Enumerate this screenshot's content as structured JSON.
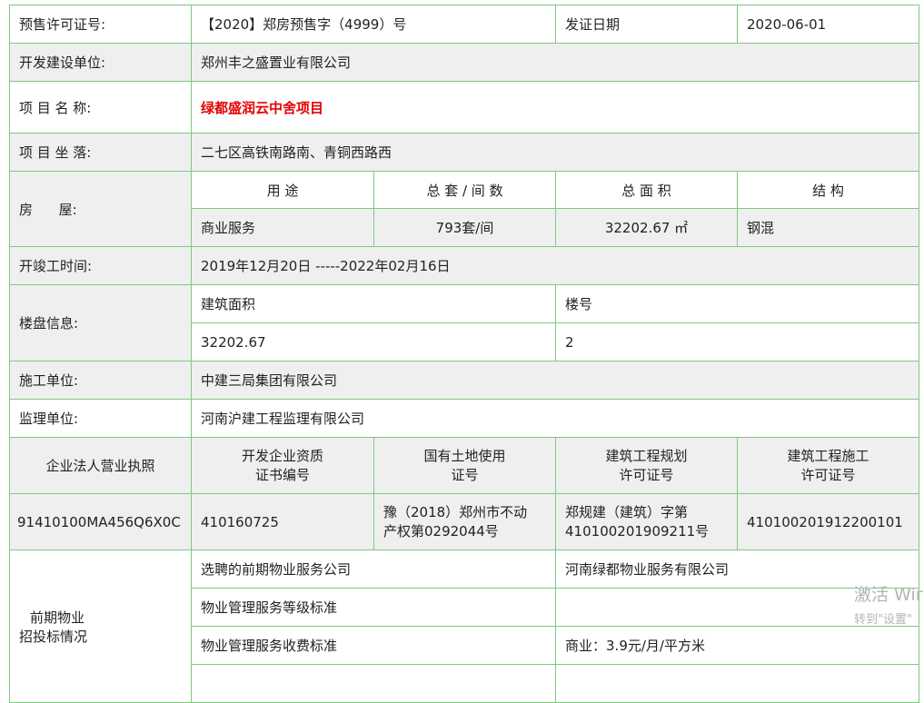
{
  "permit": {
    "label": "预售许可证号:",
    "value": "【2020】郑房预售字（4999）号",
    "issue_date_label": "发证日期",
    "issue_date": "2020-06-01"
  },
  "developer": {
    "label": "开发建设单位:",
    "value": "郑州丰之盛置业有限公司"
  },
  "project_name": {
    "label": "项 目 名 称:",
    "value": "绿都盛润云中舍项目",
    "highlight_color": "#e60000"
  },
  "location": {
    "label": "项 目 坐 落:",
    "value": "二七区高铁南路南、青铜西路西"
  },
  "housing": {
    "label": "房      屋:",
    "headers": [
      "用  途",
      "总 套 / 间 数",
      "总 面 积",
      "结 构"
    ],
    "values": [
      "商业服务",
      "793套/间",
      "32202.67 ㎡",
      "钢混"
    ]
  },
  "construction_period": {
    "label": "开竣工时间:",
    "value": "2019年12月20日 -----2022年02月16日"
  },
  "building": {
    "label": "楼盘信息:",
    "area_label": "建筑面积",
    "number_label": "楼号",
    "area_value": "32202.67",
    "number_value": "2"
  },
  "contractor": {
    "label": "施工单位:",
    "value": "中建三局集团有限公司"
  },
  "supervisor": {
    "label": "监理单位:",
    "value": "河南沪建工程监理有限公司"
  },
  "licenses": {
    "label": "企业法人营业执照",
    "headers": [
      [
        "开发企业资质",
        "证书编号"
      ],
      [
        "国有土地使用",
        "证号"
      ],
      [
        "建筑工程规划",
        "许可证号"
      ],
      [
        "建筑工程施工",
        "许可证号"
      ]
    ],
    "business_license": "91410100MA456Q6X0C",
    "qualification_no": "410160725",
    "land_use": [
      "豫（2018）郑州市不动",
      "产权第0292044号"
    ],
    "planning_permit": [
      "郑规建（建筑）字第",
      "410100201909211号"
    ],
    "construction_permit": "410100201912200101"
  },
  "property_mgmt": {
    "label": [
      "前期物业",
      "招投标情况"
    ],
    "company_label": "选聘的前期物业服务公司",
    "company_value": "河南绿都物业服务有限公司",
    "level_label": "物业管理服务等级标准",
    "level_value": "",
    "fee_label": "物业管理服务收费标准",
    "fee_value": "商业：3.9元/月/平方米"
  },
  "watermark": {
    "line1": "激活 Wir",
    "line2": "转到\"设置\""
  }
}
